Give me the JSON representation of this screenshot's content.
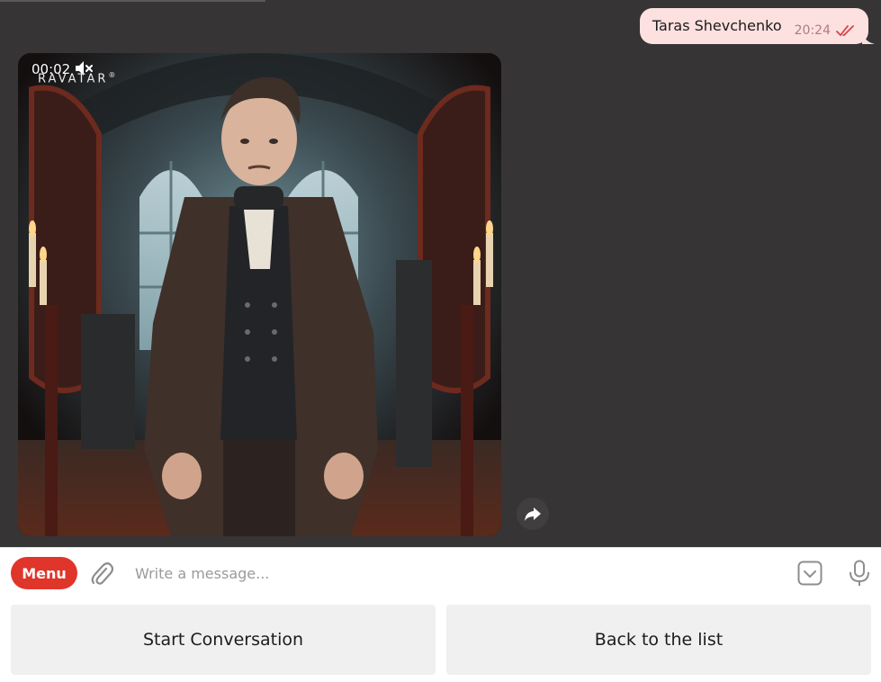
{
  "chat": {
    "outgoing_message": {
      "text": "Taras Shevchenko",
      "time": "20:24",
      "status_icon": "double-check-icon"
    },
    "video_message": {
      "duration": "00:02",
      "muted": true,
      "logo_text": "RAVATAR",
      "logo_mark": "®",
      "share_icon": "share-arrow-icon"
    }
  },
  "composer": {
    "menu_label": "Menu",
    "placeholder": "Write a message...",
    "attach_icon": "paperclip-icon",
    "keyboard_icon": "bot-keyboard-icon",
    "mic_icon": "microphone-icon"
  },
  "keyboard": {
    "buttons": [
      "Start Conversation",
      "Back to the list"
    ]
  },
  "colors": {
    "chat_background": "#363435",
    "bubble_background": "#fde0e0",
    "accent": "#e0352b",
    "button_background": "#f0f0f0"
  }
}
